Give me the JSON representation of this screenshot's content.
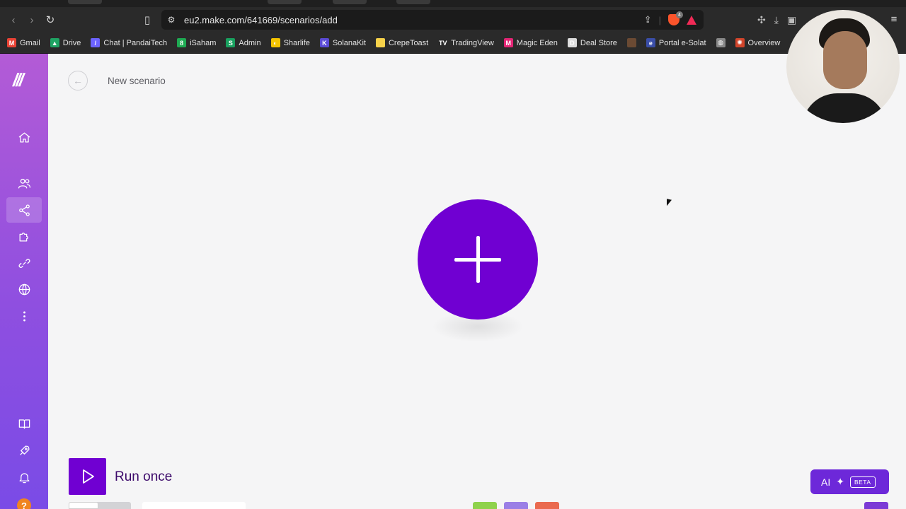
{
  "browser": {
    "url": "eu2.make.com/641669/scenarios/add",
    "bookmarks": [
      {
        "label": "Gmail",
        "icon": "gmail-icon",
        "color": "#ea4335",
        "glyph": "M"
      },
      {
        "label": "Drive",
        "icon": "drive-icon",
        "color": "#1fa463",
        "glyph": "▲"
      },
      {
        "label": "Chat | PandaiTech",
        "icon": "pandaitech-icon",
        "color": "#6c63ff",
        "glyph": "/"
      },
      {
        "label": "iSaham",
        "icon": "isaham-icon",
        "color": "#1eaa52",
        "glyph": "8"
      },
      {
        "label": "Admin",
        "icon": "admin-icon",
        "color": "#19a15f",
        "glyph": "S"
      },
      {
        "label": "Sharlife",
        "icon": "sharlife-icon",
        "color": "#f5c400",
        "glyph": "◐"
      },
      {
        "label": "SolanaKit",
        "icon": "solanakit-icon",
        "color": "#5b4bd6",
        "glyph": "K"
      },
      {
        "label": "CrepeToast",
        "icon": "crepetoast-icon",
        "color": "#f7d24a",
        "glyph": ""
      },
      {
        "label": "TradingView",
        "icon": "tradingview-icon",
        "color": "#2a2a2a",
        "glyph": "TV"
      },
      {
        "label": "Magic Eden",
        "icon": "magic-eden-icon",
        "color": "#e42575",
        "glyph": "M"
      },
      {
        "label": "Deal Store",
        "icon": "deal-store-icon",
        "color": "#dddddd",
        "glyph": "D"
      },
      {
        "label": "",
        "icon": "profile-bookmark-icon",
        "color": "#6b4a33",
        "glyph": ""
      },
      {
        "label": "Portal e-Solat",
        "icon": "esolat-icon",
        "color": "#3a4ea8",
        "glyph": "e"
      },
      {
        "label": "",
        "icon": "globe-bookmark-icon",
        "color": "#888888",
        "glyph": "◍"
      },
      {
        "label": "Overview",
        "icon": "overview-icon",
        "color": "#d2452b",
        "glyph": "✺"
      }
    ]
  },
  "sidebar": {
    "logo": "///",
    "help_label": "?"
  },
  "header": {
    "title": "New scenario"
  },
  "canvas": {
    "add_module_icon": "plus-icon"
  },
  "footer": {
    "run_label": "Run once",
    "ai_label": "AI",
    "ai_badge": "BETA"
  },
  "colors": {
    "accent": "#7000d2",
    "sidebar_top": "#b35bd6",
    "sidebar_bottom": "#7a4be6",
    "ai_button": "#6d28d9",
    "help": "#f0841f"
  }
}
